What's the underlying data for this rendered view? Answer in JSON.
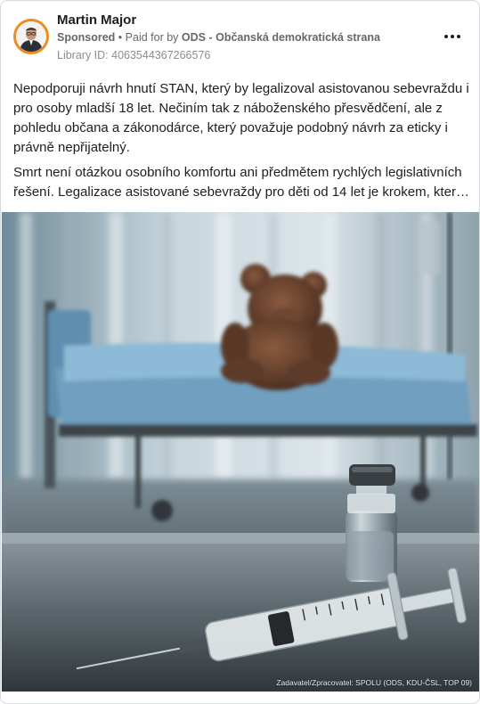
{
  "post": {
    "author_name": "Martin Major",
    "sponsored_label": "Sponsored",
    "separator": "•",
    "paid_for_prefix": "Paid for by",
    "paid_for_by": "ODS - Občanská demokratická strana",
    "library_id": "Library ID: 4063544367266576",
    "more_icon": "more-horizontal-icon",
    "paragraph_1": "Nepodporuji návrh hnutí STAN, který by legalizoval asistovanou sebevraždu i pro osoby mladší 18 let. Nečiním tak z náboženského přesvědčení, ale z pohledu občana a zákonodárce, který považuje podobný návrh za eticky i právně nepřijatelný.",
    "paragraph_2_line_1": "Smrt není otázkou osobního komfortu ani předmětem rychlých legislativních",
    "paragraph_2_line_2": "řešení. Legalizace asistované sebevraždy pro děti od 14 let je krokem, který popír…"
  },
  "media": {
    "credit": "Zadavatel/Zpracovatel: SPOLU (ODS, KDU-ČSL, TOP 09)"
  },
  "colors": {
    "avatar_ring": "#f08a1c",
    "text_primary": "#1c1e21",
    "text_secondary": "#65676b",
    "bed_sheet": "#6f9fc0",
    "vial_cap": "#3a3f44"
  }
}
